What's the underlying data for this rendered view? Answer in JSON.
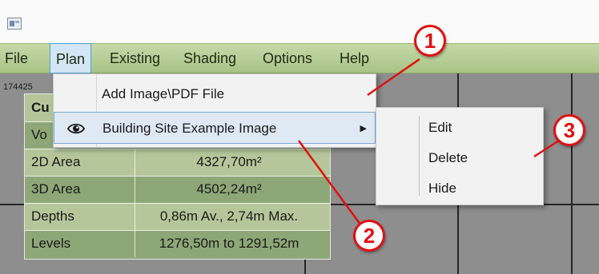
{
  "menubar": {
    "items": [
      {
        "label": "File"
      },
      {
        "label": "Plan"
      },
      {
        "label": "Existing"
      },
      {
        "label": "Shading"
      },
      {
        "label": "Options"
      },
      {
        "label": "Help"
      }
    ],
    "active": "Plan"
  },
  "canvas": {
    "coord_text": "174425"
  },
  "panel": {
    "rows": [
      {
        "label": "Cu",
        "value": ""
      },
      {
        "label": "Vo",
        "value": ""
      },
      {
        "label": "2D Area",
        "value": "4327,70m²"
      },
      {
        "label": "3D Area",
        "value": "4502,24m²"
      },
      {
        "label": "Depths",
        "value": "0,86m Av., 2,74m Max."
      },
      {
        "label": "Levels",
        "value": "1276,50m to 1291,52m"
      }
    ]
  },
  "dropdown": {
    "items": [
      {
        "label": "Add Image\\PDF File",
        "icon": ""
      },
      {
        "label": "Building Site Example Image",
        "icon": "eye-icon",
        "has_submenu": true
      }
    ]
  },
  "submenu": {
    "items": [
      {
        "label": "Edit"
      },
      {
        "label": "Delete"
      },
      {
        "label": "Hide"
      }
    ]
  },
  "callouts": [
    "1",
    "2",
    "3"
  ],
  "colors": {
    "menubar": "#b6cf95",
    "panel_light": "#b5c79a",
    "panel_dark": "#8ea777",
    "callout": "#e01010",
    "selection": "#dfe9f4"
  }
}
